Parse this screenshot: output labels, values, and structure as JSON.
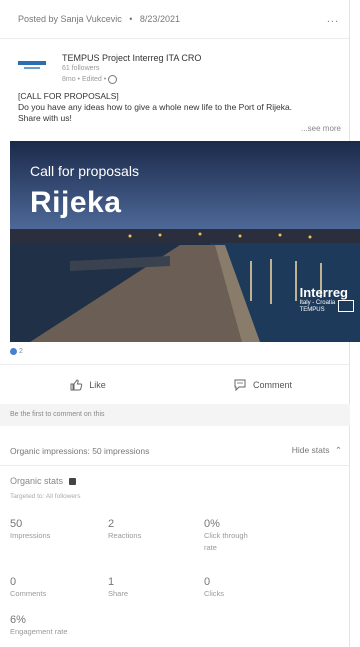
{
  "post": {
    "posted_by": "Posted by Sanja Vukcevic",
    "separator": "•",
    "date": "8/23/2021",
    "more": "...",
    "author_name": "TEMPUS Project Interreg ITA CRO",
    "author_followers": "61 followers",
    "author_edited": "8mo • Edited •",
    "text_line1": "[CALL FOR PROPOSALS]",
    "text_line2": "Do you have any ideas how to give a whole new life to the Port of Rijeka.",
    "text_line3": "Share with us!",
    "see_more": "...see more",
    "image_title": "Call for proposals",
    "image_city": "Rijeka",
    "brand_main": "Interreg",
    "brand_sub1": "Italy - Croatia",
    "brand_sub2": "TEMPUS"
  },
  "reactions": {
    "count": "2"
  },
  "actions": {
    "like": "Like",
    "comment": "Comment"
  },
  "first_comment": "Be the first to comment on this",
  "impressions": {
    "label": "Organic impressions: 50 impressions",
    "hide_stats": "Hide stats"
  },
  "organic": {
    "title": "Organic stats",
    "targeted": "Targeted to: All followers",
    "stats": [
      {
        "value": "50",
        "label1": "Impressions",
        "label2": ""
      },
      {
        "value": "2",
        "label1": "Reactions",
        "label2": ""
      },
      {
        "value": "0%",
        "label1": "Click through",
        "label2": "rate"
      },
      {
        "value": "0",
        "label1": "Comments",
        "label2": ""
      },
      {
        "value": "1",
        "label1": "Share",
        "label2": ""
      },
      {
        "value": "0",
        "label1": "Clicks",
        "label2": ""
      },
      {
        "value": "6%",
        "label1": "Engagement rate",
        "label2": ""
      }
    ]
  }
}
